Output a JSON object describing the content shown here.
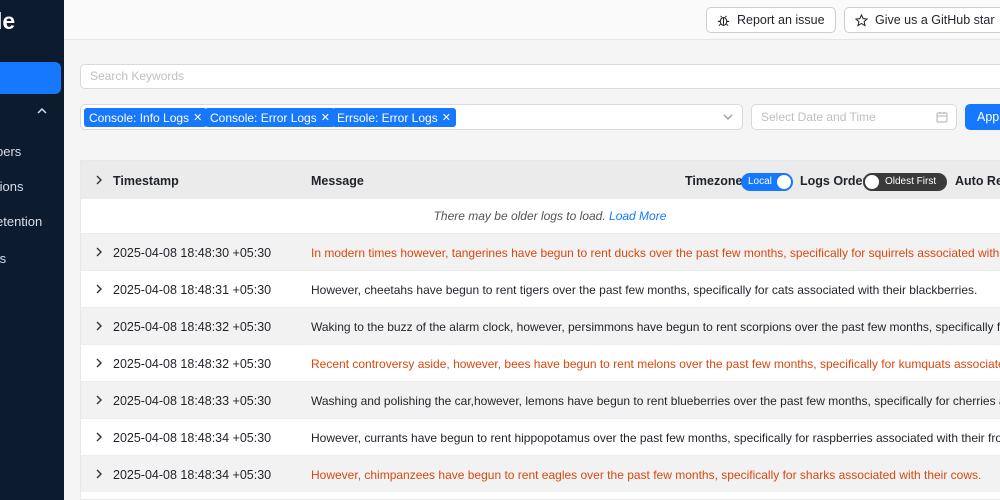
{
  "sidebar": {
    "brand": "le",
    "items": [
      {
        "label": "pers"
      },
      {
        "label": "tions"
      },
      {
        "label": "etention"
      },
      {
        "label": "ts"
      }
    ]
  },
  "header": {
    "report_label": "Report an issue",
    "star_label": "Give us a GitHub star"
  },
  "search": {
    "placeholder": "Search Keywords"
  },
  "filters": {
    "tags": [
      "Console: Info Logs",
      "Console: Error Logs",
      "Errsole: Error Logs"
    ],
    "date_placeholder": "Select Date and Time",
    "apply_label": "Appl"
  },
  "table": {
    "col_timestamp": "Timestamp",
    "col_message": "Message",
    "timezone_label": "Timezone",
    "timezone_value": "Local",
    "order_label": "Logs Order",
    "order_value": "Oldest First",
    "auto_refresh_label": "Auto Ref",
    "notice_text": "There may be older logs to load.",
    "load_more": "Load More",
    "rows": [
      {
        "timestamp": "2025-04-08 18:48:30 +05:30",
        "message": "In modern times however, tangerines have begun to rent ducks over the past few months, specifically for squirrels associated with their",
        "level": "error"
      },
      {
        "timestamp": "2025-04-08 18:48:31 +05:30",
        "message": "However, cheetahs have begun to rent tigers over the past few months, specifically for cats associated with their blackberries.",
        "level": "info"
      },
      {
        "timestamp": "2025-04-08 18:48:32 +05:30",
        "message": "Waking to the buzz of the alarm clock, however, persimmons have begun to rent scorpions over the past few months, specifically for fig",
        "level": "info"
      },
      {
        "timestamp": "2025-04-08 18:48:32 +05:30",
        "message": "Recent controversy aside, however, bees have begun to rent melons over the past few months, specifically for kumquats associated wi",
        "level": "error"
      },
      {
        "timestamp": "2025-04-08 18:48:33 +05:30",
        "message": "Washing and polishing the car,however, lemons have begun to rent blueberries over the past few months, specifically for cherries asso",
        "level": "info"
      },
      {
        "timestamp": "2025-04-08 18:48:34 +05:30",
        "message": "However, currants have begun to rent hippopotamus over the past few months, specifically for raspberries associated with their frogs.",
        "level": "info"
      },
      {
        "timestamp": "2025-04-08 18:48:34 +05:30",
        "message": "However, chimpanzees have begun to rent eagles over the past few months, specifically for sharks associated with their cows.",
        "level": "error"
      }
    ]
  },
  "colors": {
    "accent": "#1677ff",
    "sidebar_bg": "#0d1b2e",
    "error_text": "#d9480f",
    "toggle_dark": "#3a3a3a"
  }
}
